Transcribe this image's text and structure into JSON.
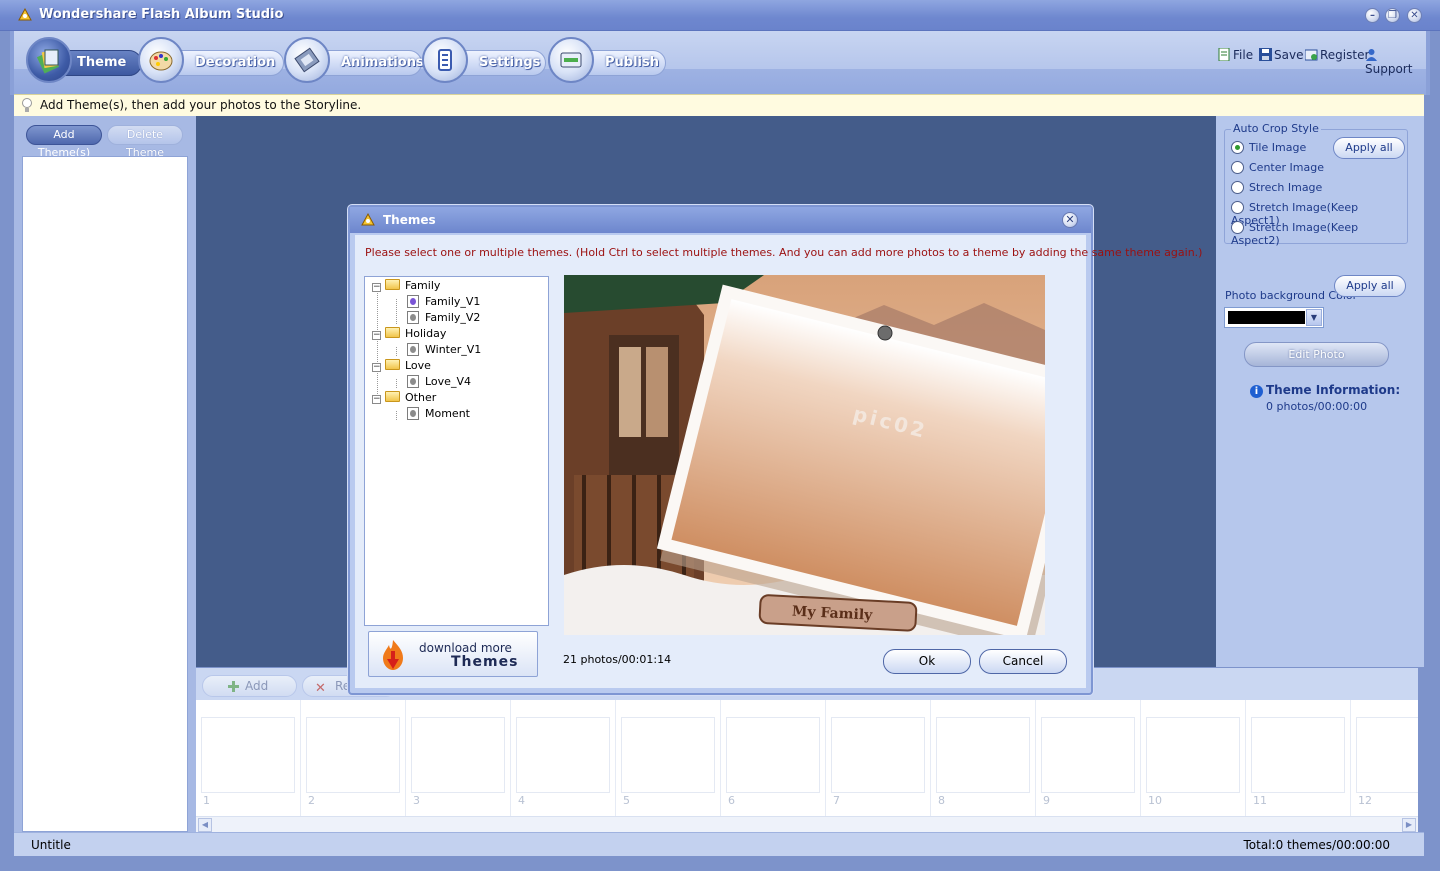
{
  "window": {
    "title": "Wondershare Flash Album Studio",
    "controls": {
      "minimize": "–",
      "restore": "❐",
      "close": "✕"
    }
  },
  "tabs": [
    {
      "label": "Theme",
      "icon": "theme-icon",
      "active": true
    },
    {
      "label": "Decoration",
      "icon": "palette-icon",
      "active": false
    },
    {
      "label": "Animations",
      "icon": "film-icon",
      "active": false
    },
    {
      "label": "Settings",
      "icon": "settings-icon",
      "active": false
    },
    {
      "label": "Publish",
      "icon": "publish-icon",
      "active": false
    }
  ],
  "top_links": [
    {
      "label": "File",
      "icon": "file-icon"
    },
    {
      "label": "Save",
      "icon": "save-icon"
    },
    {
      "label": "Register",
      "icon": "register-icon"
    },
    {
      "label": "Support",
      "icon": "support-icon"
    }
  ],
  "hint": "Add Theme(s), then add your photos to the Storyline.",
  "left_panel": {
    "add_theme": "Add Theme(s)",
    "delete_theme": "Delete Theme"
  },
  "right_panel": {
    "crop_style_label": "Auto Crop Style",
    "crop_options": [
      {
        "label": "Tile Image",
        "checked": true
      },
      {
        "label": "Center Image",
        "checked": false
      },
      {
        "label": "Strech Image",
        "checked": false
      },
      {
        "label": "Stretch Image(Keep Aspect1)",
        "checked": false
      },
      {
        "label": "Stretch Image(Keep Aspect2)",
        "checked": false
      }
    ],
    "apply_all": "Apply all",
    "bg_color_label": "Photo background Color",
    "bg_color_value": "#000000",
    "apply_all_2": "Apply all",
    "edit_photo": "Edit Photo",
    "theme_info_title": "Theme Information:",
    "theme_info_value": "0 photos/00:00:00"
  },
  "storyline": {
    "add_label": "Add",
    "remove_label": "Re",
    "slots": [
      "1",
      "2",
      "3",
      "4",
      "5",
      "6",
      "7",
      "8",
      "9",
      "10",
      "11",
      "12"
    ]
  },
  "status": {
    "left": "Untitle",
    "right": "Total:0 themes/00:00:00"
  },
  "dialog": {
    "title": "Themes",
    "instruction": "Please select one or multiple themes. (Hold Ctrl to select multiple themes. And you can add more photos to a theme by adding the same theme again.)",
    "tree": [
      {
        "label": "Family",
        "children": [
          "Family_V1",
          "Family_V2"
        ]
      },
      {
        "label": "Holiday",
        "children": [
          "Winter_V1"
        ]
      },
      {
        "label": "Love",
        "children": [
          "Love_V4"
        ]
      },
      {
        "label": "Other",
        "children": [
          "Moment"
        ]
      }
    ],
    "selected_theme": "Family_V1",
    "download_line1": "download more",
    "download_line2": "Themes",
    "preview_photo_label": "pic02",
    "preview_banner": "My Family",
    "photo_count": "21 photos/00:01:14",
    "ok": "Ok",
    "cancel": "Cancel"
  }
}
